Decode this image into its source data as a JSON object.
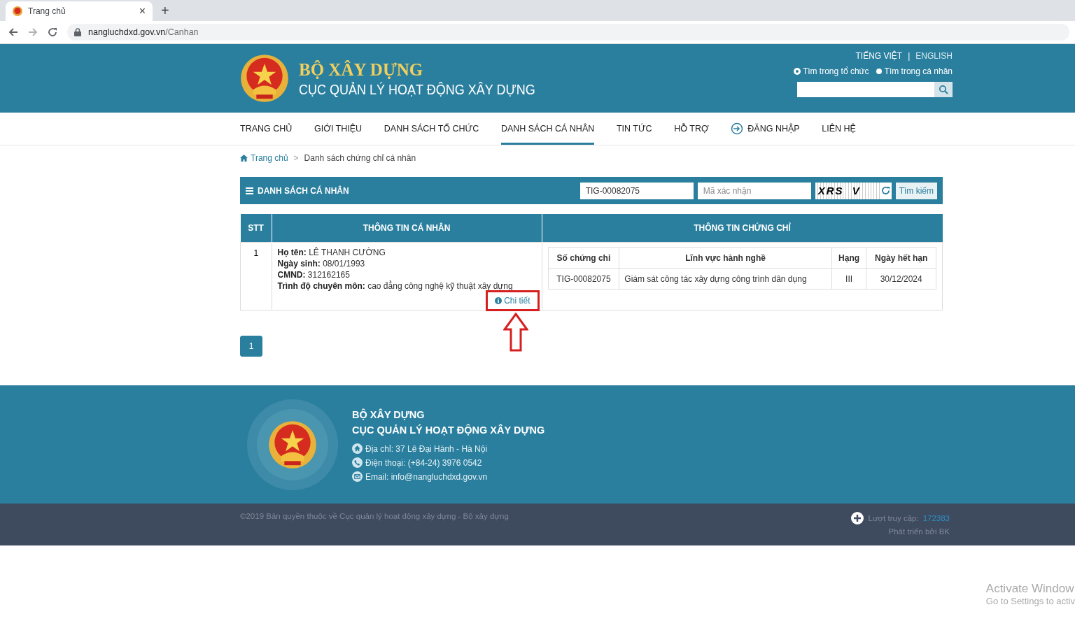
{
  "browser": {
    "tab": {
      "title": "Trang chủ",
      "close": "×"
    },
    "new_tab": "+",
    "url_host": "nangluchdxd.gov.vn",
    "url_path": "/Canhan"
  },
  "header": {
    "title": "BỘ XÂY DỰNG",
    "subtitle": "CỤC QUẢN LÝ HOẠT ĐỘNG XÂY DỰNG",
    "languages": [
      {
        "label": "TIẾNG VIỆT",
        "selected": true
      },
      {
        "label": "ENGLISH",
        "selected": false
      }
    ],
    "lang_separator": "|",
    "search_scopes": [
      {
        "label": "Tìm trong tổ chức",
        "selected": true
      },
      {
        "label": "Tìm trong cá nhân",
        "selected": false
      }
    ]
  },
  "nav": [
    {
      "label": "TRANG CHỦ",
      "selected": false,
      "kind": "link"
    },
    {
      "label": "GIỚI THIỆU",
      "selected": false,
      "kind": "link"
    },
    {
      "label": "DANH SÁCH TỔ CHỨC",
      "selected": false,
      "kind": "link"
    },
    {
      "label": "DANH SÁCH CÁ NHÂN",
      "selected": true,
      "kind": "link"
    },
    {
      "label": "TIN TỨC",
      "selected": false,
      "kind": "link"
    },
    {
      "label": "HỖ TRỢ",
      "selected": false,
      "kind": "link"
    },
    {
      "label": "ĐĂNG NHẬP",
      "selected": false,
      "kind": "login"
    },
    {
      "label": "LIÊN HỆ",
      "selected": false,
      "kind": "link"
    }
  ],
  "breadcrumb": {
    "home": "Trang chủ",
    "separator": ">",
    "current": "Danh sách chứng chỉ cá nhân"
  },
  "panel": {
    "title": "DANH SÁCH CÁ NHÂN",
    "search_value": "TIG-00082075",
    "captcha_placeholder": "Mã xác nhận",
    "captcha": "XRS  V",
    "search_button": "Tìm kiếm"
  },
  "table": {
    "columns": [
      "STT",
      "THÔNG TIN CÁ NHÂN",
      "THÔNG TIN CHỨNG CHỈ"
    ],
    "rows": [
      {
        "stt": "1",
        "info": [
          "**Họ tên:** LÊ THANH CƯỜNG",
          "**Ngày sinh:** 08/01/1993",
          "**CMND:** 312162165",
          "**Trình độ chuyên môn:** cao đẳng công nghệ kỹ thuật xây dựng"
        ],
        "detail_link": "Chi tiết",
        "highlighted": true,
        "certificates": {
          "columns": [
            "Số chứng chỉ",
            "Lĩnh vực hành nghề",
            "Hạng",
            "Ngày hết hạn"
          ],
          "rows": [
            [
              "TIG-00082075",
              "Giám sát công tác xây dựng công trình dân dụng",
              "III",
              "30/12/2024"
            ]
          ]
        }
      }
    ]
  },
  "pagination": [
    {
      "label": "1",
      "selected": true
    }
  ],
  "footer": {
    "title": "BỘ XÂY DỰNG",
    "subtitle": "CỤC QUẢN LÝ HOẠT ĐỘNG XÂY DỰNG",
    "contacts": [
      {
        "kind": "address",
        "text": "Địa chỉ: 37 Lê Đại Hành - Hà Nội"
      },
      {
        "kind": "phone",
        "text": "Điện thoại: (+84-24) 3976 0542"
      },
      {
        "kind": "email",
        "text": "Email: info@nangluchdxd.gov.vn"
      }
    ],
    "copyright": "©2019 Bản quyền thuộc về Cục quản lý hoạt động xây dựng - Bộ xây dựng",
    "visits_label": "Lượt truy cập:",
    "visits": "172383",
    "developer": "Phát triển bởi BK"
  },
  "os_notice": {
    "title": "Activate Window",
    "subtitle": "Go to Settings to activ"
  }
}
